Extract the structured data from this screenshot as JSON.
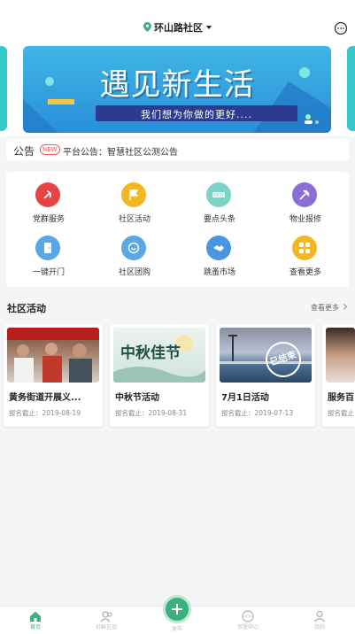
{
  "header": {
    "location": "环山路社区",
    "icons": {
      "location": "location-pin-icon",
      "chat": "chat-bubble-icon"
    }
  },
  "banner": {
    "title": "遇见新生活",
    "subtitle": "我们想为你做的更好....",
    "slide_count": 2,
    "active_slide": 1
  },
  "notice": {
    "logo": "公告",
    "badge": "NEW",
    "text": "平台公告：智慧社区公测公告"
  },
  "services": [
    {
      "label": "党群服务",
      "icon": "party-icon",
      "color": "#e84343"
    },
    {
      "label": "社区活动",
      "icon": "flag-icon",
      "color": "#f3b71f"
    },
    {
      "label": "要点头条",
      "icon": "new-badge-icon",
      "color": "#7ed3c9"
    },
    {
      "label": "物业报修",
      "icon": "hammer-icon",
      "color": "#8a6fd6"
    },
    {
      "label": "一键开门",
      "icon": "door-icon",
      "color": "#5aa7e8"
    },
    {
      "label": "社区团购",
      "icon": "group-buy-icon",
      "color": "#5aa7e8"
    },
    {
      "label": "跳蚤市场",
      "icon": "handshake-icon",
      "color": "#4a95e0"
    },
    {
      "label": "查看更多",
      "icon": "more-grid-icon",
      "color": "#f3b71f"
    }
  ],
  "section": {
    "title": "社区活动",
    "more": "查看更多"
  },
  "activities": [
    {
      "title": "黄务街道开展义...",
      "date": "报名截止：2019-08-19",
      "ended": ""
    },
    {
      "title": "中秋节活动",
      "date": "报名截止：2019-08-31",
      "ended": "",
      "image_text": "中秋佳节"
    },
    {
      "title": "7月1日活动",
      "date": "报名截止：2019-07-13",
      "ended": "已结束"
    },
    {
      "title": "服务百",
      "date": "报名截止",
      "ended": ""
    }
  ],
  "nav": {
    "items": [
      {
        "label": "首页",
        "icon": "home-icon",
        "active": true
      },
      {
        "label": "社群互动",
        "icon": "community-icon",
        "active": false
      },
      {
        "label": "发布",
        "icon": "plus-icon",
        "active": false
      },
      {
        "label": "邻里中心",
        "icon": "message-icon",
        "active": false
      },
      {
        "label": "我的",
        "icon": "user-icon",
        "active": false
      }
    ]
  },
  "colors": {
    "accent": "#3bb07e",
    "banner": "#2a8fd8",
    "teal": "#35c7c9"
  }
}
